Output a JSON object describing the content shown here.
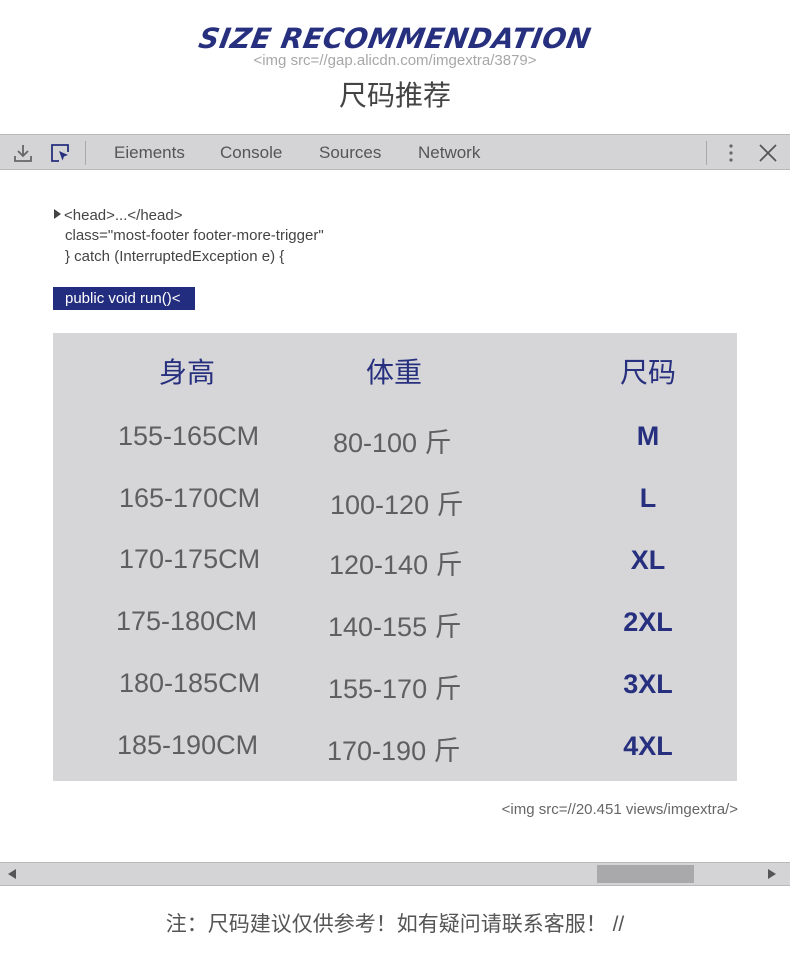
{
  "header": {
    "title": "SIZE RECOMMENDATION",
    "img_src_top": "<img src=//gap.alicdn.com/imgextra/3879>",
    "subtitle": "尺码推荐"
  },
  "devtools": {
    "tabs": [
      "Eiements",
      "Console",
      "Sources",
      "Network"
    ],
    "icons": [
      "download-icon",
      "inspect-element-icon",
      "more-vertical-icon",
      "close-icon"
    ]
  },
  "code": {
    "line1": "<head>...</head>",
    "line2": "class=\"most-footer footer-more-trigger\"",
    "line3": "} catch (InterruptedException e) {",
    "highlighted": "public void run()<"
  },
  "table": {
    "headers": [
      "身高",
      "体重",
      "尺码"
    ],
    "rows": [
      {
        "height": "155-165CM",
        "weight": "80-100 斤",
        "size": "M"
      },
      {
        "height": "165-170CM",
        "weight": "100-120 斤",
        "size": "L"
      },
      {
        "height": "170-175CM",
        "weight": "120-140 斤",
        "size": "XL"
      },
      {
        "height": "175-180CM",
        "weight": "140-155 斤",
        "size": "2XL"
      },
      {
        "height": "180-185CM",
        "weight": "155-170 斤",
        "size": "3XL"
      },
      {
        "height": "185-190CM",
        "weight": "170-190 斤",
        "size": "4XL"
      }
    ]
  },
  "img_src_bottom": "<img src=//20.451 views/imgextra/>",
  "note": "注：尺码建议仅供参考！如有疑问请联系客服！ //",
  "colors": {
    "accent": "#27307e",
    "table_bg": "#d6d6d9",
    "devbar_bg": "#d4d4d6"
  }
}
